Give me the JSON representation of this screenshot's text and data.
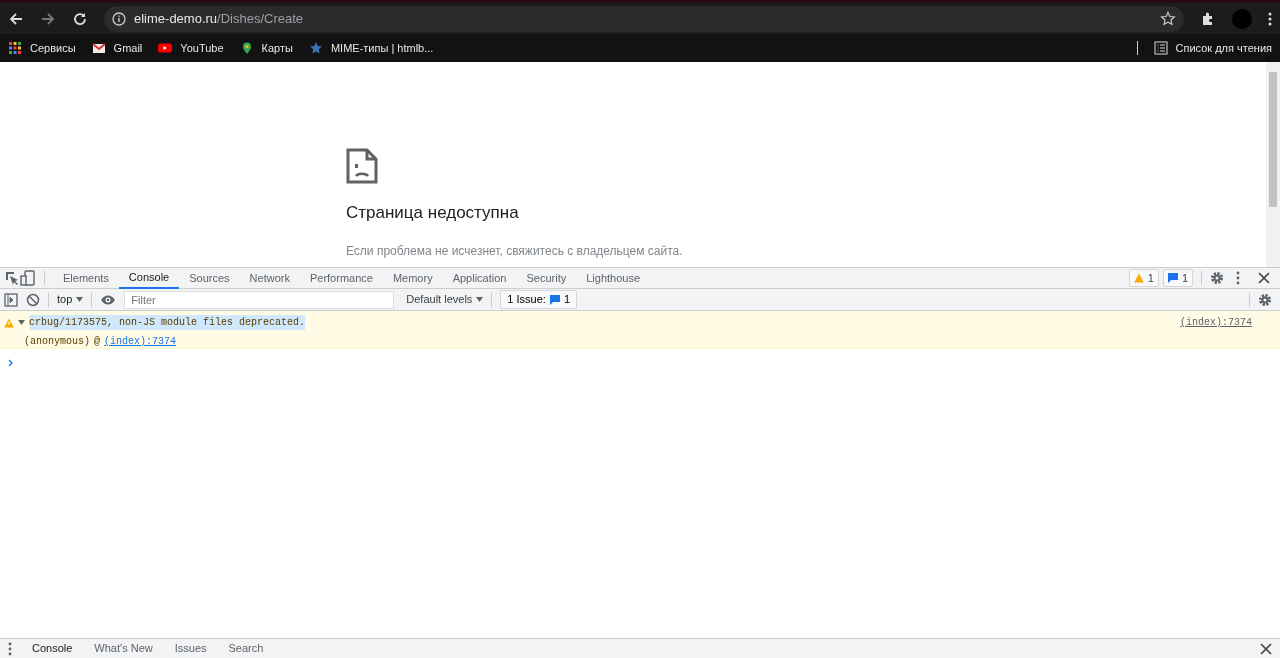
{
  "browser": {
    "url": {
      "host": "elime-demo.ru",
      "path": "/Dishes/Create"
    },
    "bookmarks": [
      {
        "kind": "apps",
        "label": "Сервисы"
      },
      {
        "kind": "mail",
        "label": "Gmail"
      },
      {
        "kind": "video",
        "label": "YouTube"
      },
      {
        "kind": "pin",
        "label": "Карты"
      },
      {
        "kind": "star",
        "label": "MIME-типы | htmlb..."
      }
    ],
    "reading_list": "Список для чтения"
  },
  "page": {
    "title": "Страница недоступна",
    "message": "Если проблема не исчезнет, свяжитесь с владельцем сайта."
  },
  "devtools": {
    "tabs": [
      {
        "label": "Elements",
        "selected": false
      },
      {
        "label": "Console",
        "selected": true
      },
      {
        "label": "Sources",
        "selected": false
      },
      {
        "label": "Network",
        "selected": false
      },
      {
        "label": "Performance",
        "selected": false
      },
      {
        "label": "Memory",
        "selected": false
      },
      {
        "label": "Application",
        "selected": false
      },
      {
        "label": "Security",
        "selected": false
      },
      {
        "label": "Lighthouse",
        "selected": false
      }
    ],
    "warning_count": "1",
    "info_count": "1",
    "toolbar": {
      "context": "top",
      "filter": {
        "placeholder": "Filter"
      },
      "levels": "Default levels",
      "issues_label": "1 Issue:",
      "issues_count": "1"
    },
    "messages": [
      {
        "kind": "warning",
        "expanded": true,
        "text": "crbug/1173575, non-JS module files deprecated.",
        "source": "(index):7374",
        "stack": [
          {
            "function": "(anonymous)",
            "at": "@",
            "link": "(index):7374"
          }
        ]
      }
    ],
    "drawer_tabs": [
      {
        "label": "Console",
        "selected": true
      },
      {
        "label": "What's New",
        "selected": false
      },
      {
        "label": "Issues",
        "selected": false
      },
      {
        "label": "Search",
        "selected": false
      }
    ]
  }
}
